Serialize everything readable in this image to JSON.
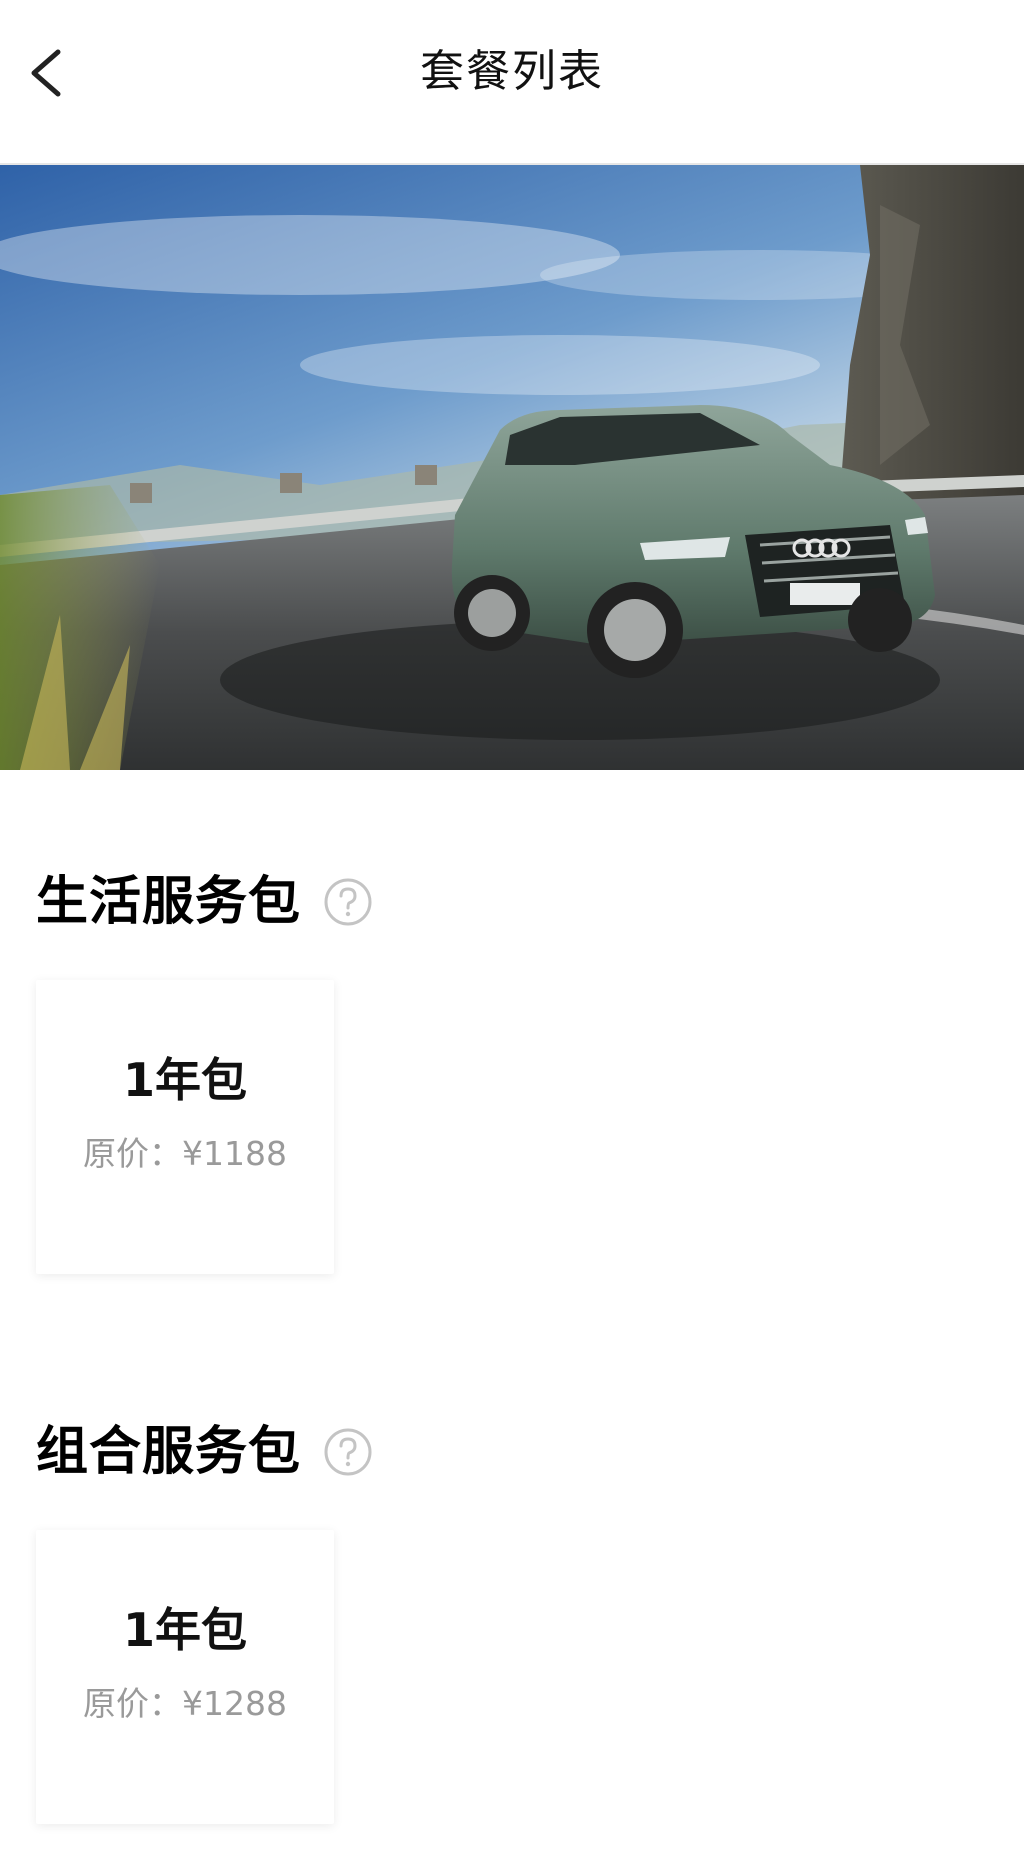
{
  "header": {
    "title": "套餐列表",
    "back_icon": "chevron-left-icon"
  },
  "hero": {
    "description": "car-banner-image"
  },
  "sections": [
    {
      "title": "生活服务包",
      "help_icon": "question-circle-icon",
      "packages": [
        {
          "name": "1年包",
          "price_label": "原价：¥1188"
        }
      ]
    },
    {
      "title": "组合服务包",
      "help_icon": "question-circle-icon",
      "packages": [
        {
          "name": "1年包",
          "price_label": "原价：¥1288"
        }
      ]
    }
  ],
  "colors": {
    "price_gray": "#9a9a9a",
    "icon_gray": "#c0c0c0",
    "divider": "#e6e6e6"
  }
}
